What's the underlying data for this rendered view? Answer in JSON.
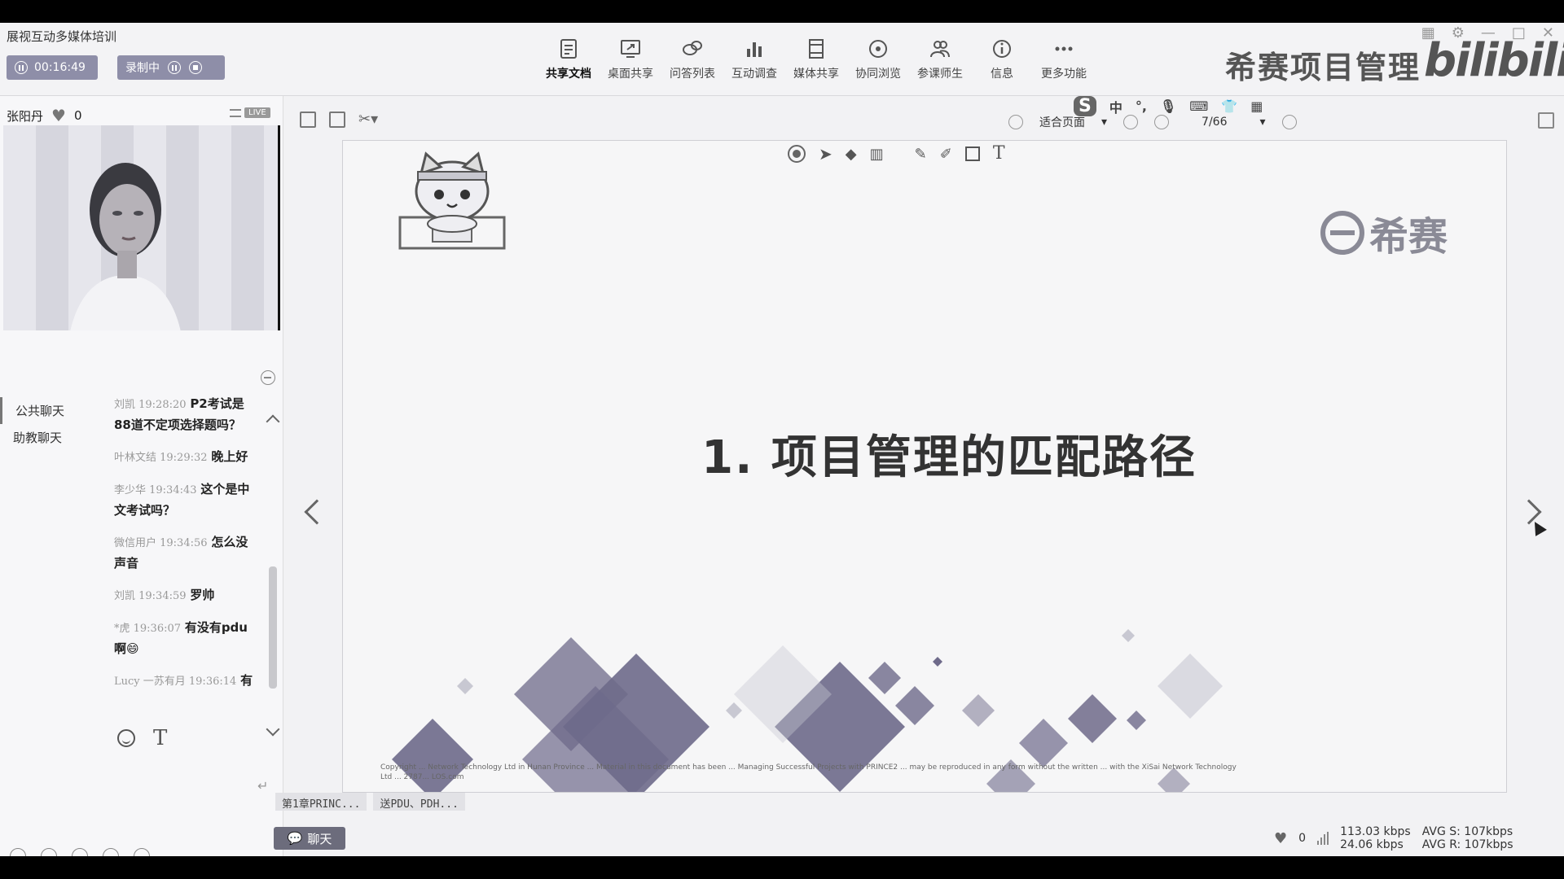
{
  "app": {
    "title": "展视互动多媒体培训"
  },
  "session": {
    "timer": "00:16:49",
    "record_label": "录制中"
  },
  "toolbar": {
    "items": [
      {
        "label": "共享文档",
        "icon": "document-icon"
      },
      {
        "label": "桌面共享",
        "icon": "desktop-share-icon"
      },
      {
        "label": "问答列表",
        "icon": "qa-icon"
      },
      {
        "label": "互动调查",
        "icon": "bar-chart-icon"
      },
      {
        "label": "媒体共享",
        "icon": "film-icon"
      },
      {
        "label": "协同浏览",
        "icon": "compass-icon"
      },
      {
        "label": "参课师生",
        "icon": "users-icon"
      },
      {
        "label": "信息",
        "icon": "info-icon"
      },
      {
        "label": "更多功能",
        "icon": "more-icon"
      }
    ]
  },
  "watermark": {
    "brand": "希赛项目管理",
    "bili": "bilibili"
  },
  "host": {
    "name": "张阳丹",
    "likes": "0",
    "live_badge": "LIVE"
  },
  "ime": {
    "logo": "S",
    "mode": "中"
  },
  "chat": {
    "tabs": [
      "公共聊天",
      "助教聊天"
    ],
    "messages": [
      {
        "meta": "刘凯 19:28:20",
        "text": "P2考试是88道不定项选择题吗？"
      },
      {
        "meta": "叶林文结 19:29:32",
        "text": "晚上好"
      },
      {
        "meta": "李少华 19:34:43",
        "text": "这个是中文考试吗？"
      },
      {
        "meta": "微信用户 19:34:56",
        "text": "怎么没声音"
      },
      {
        "meta": "刘凯 19:34:59",
        "text": "罗帅"
      },
      {
        "meta": "*虎 19:36:07",
        "text": "有没有pdu啊😄"
      },
      {
        "meta": "Lucy 一苏有月 19:36:14",
        "text": "有"
      }
    ],
    "enter_symbol": "↵"
  },
  "viewer": {
    "fit_label": "适合页面",
    "page": "7/66"
  },
  "slide": {
    "logo_text": "希赛",
    "title": "1. 项目管理的匹配路径",
    "copyright": "Copyright ... Network Technology Ltd in Hunan Province ... Material in this document has been ... Managing Successful Projects with PRINCE2 ... may be reproduced in any form without the written ... with the XiSai Network Technology Ltd ... 2787... LOS.com"
  },
  "doc_tabs": [
    "第1章PRINC...",
    "送PDU、PDH..."
  ],
  "status": {
    "chat_button": "聊天",
    "likes": "0",
    "up_rate": "113.03 kbps",
    "down_rate": "24.06 kbps",
    "avg_s": "AVG S: 107kbps",
    "avg_r": "AVG R: 107kbps"
  },
  "colors": {
    "accent": "#8e8ea8",
    "slide_shape": "#6e6a8a",
    "chat_button": "#6c6c7c"
  }
}
